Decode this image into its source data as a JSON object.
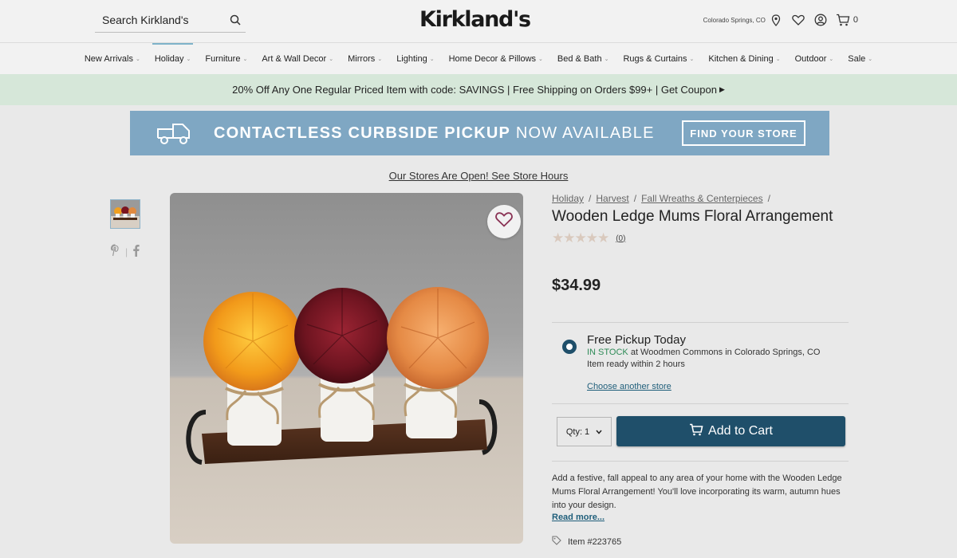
{
  "header": {
    "search_placeholder": "Search Kirkland's",
    "logo": "Kirkland's",
    "location": "Colorado Springs, CO",
    "cart_count": "0"
  },
  "nav": {
    "items": [
      "New Arrivals",
      "Holiday",
      "Furniture",
      "Art & Wall Decor",
      "Mirrors",
      "Lighting",
      "Home Decor & Pillows",
      "Bed & Bath",
      "Rugs & Curtains",
      "Kitchen & Dining",
      "Outdoor",
      "Sale"
    ],
    "active": "Holiday"
  },
  "promo": {
    "text": "20% Off Any One Regular Priced Item with code: SAVINGS | Free Shipping on Orders $99+ | Get Coupon"
  },
  "banner": {
    "bold": "CONTACTLESS CURBSIDE PICKUP",
    "light": "NOW AVAILABLE",
    "button": "FIND YOUR STORE"
  },
  "store_notice": "Our Stores Are Open! See Store Hours",
  "product": {
    "breadcrumb": [
      "Holiday",
      "Harvest",
      "Fall Wreaths & Centerpieces"
    ],
    "title": "Wooden Ledge Mums Floral Arrangement",
    "rating": 0,
    "review_count": "(0)",
    "price": "$34.99",
    "pickup": {
      "title": "Free Pickup Today",
      "status": "IN STOCK",
      "location": "at Woodmen Commons in Colorado Springs, CO",
      "ready": "Item ready within 2 hours",
      "change_link": "Choose another store"
    },
    "qty_label": "Qty: 1",
    "add_to_cart": "Add to Cart",
    "description": "Add a festive, fall appeal to any area of your home with the Wooden Ledge Mums Floral Arrangement! You'll love incorporating its warm, autumn hues into your design.",
    "read_more": "Read more...",
    "item_number": "Item #223765"
  },
  "colors": {
    "primary": "#1f4f6a",
    "promo_bg": "#d6e7d9",
    "banner_bg": "#7fa7c3",
    "in_stock": "#2e8b57"
  },
  "icons": [
    "search-icon",
    "location-pin-icon",
    "heart-icon",
    "account-icon",
    "cart-icon",
    "pinterest-icon",
    "facebook-icon",
    "truck-icon",
    "tag-icon"
  ]
}
